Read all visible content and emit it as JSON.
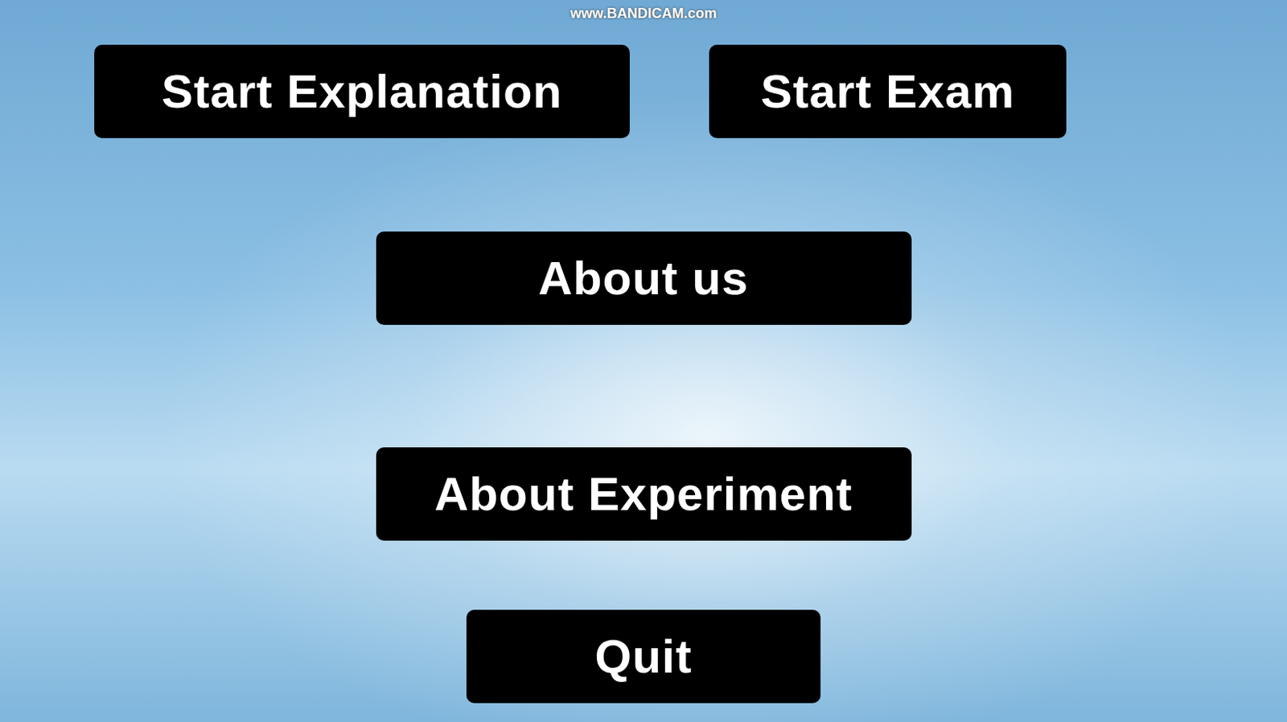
{
  "watermark": "www.BANDICAM.com",
  "menu": {
    "buttons": [
      {
        "label": "Start Explanation"
      },
      {
        "label": "Start Exam"
      },
      {
        "label": "About us"
      },
      {
        "label": "About Experiment"
      },
      {
        "label": "Quit"
      }
    ]
  }
}
